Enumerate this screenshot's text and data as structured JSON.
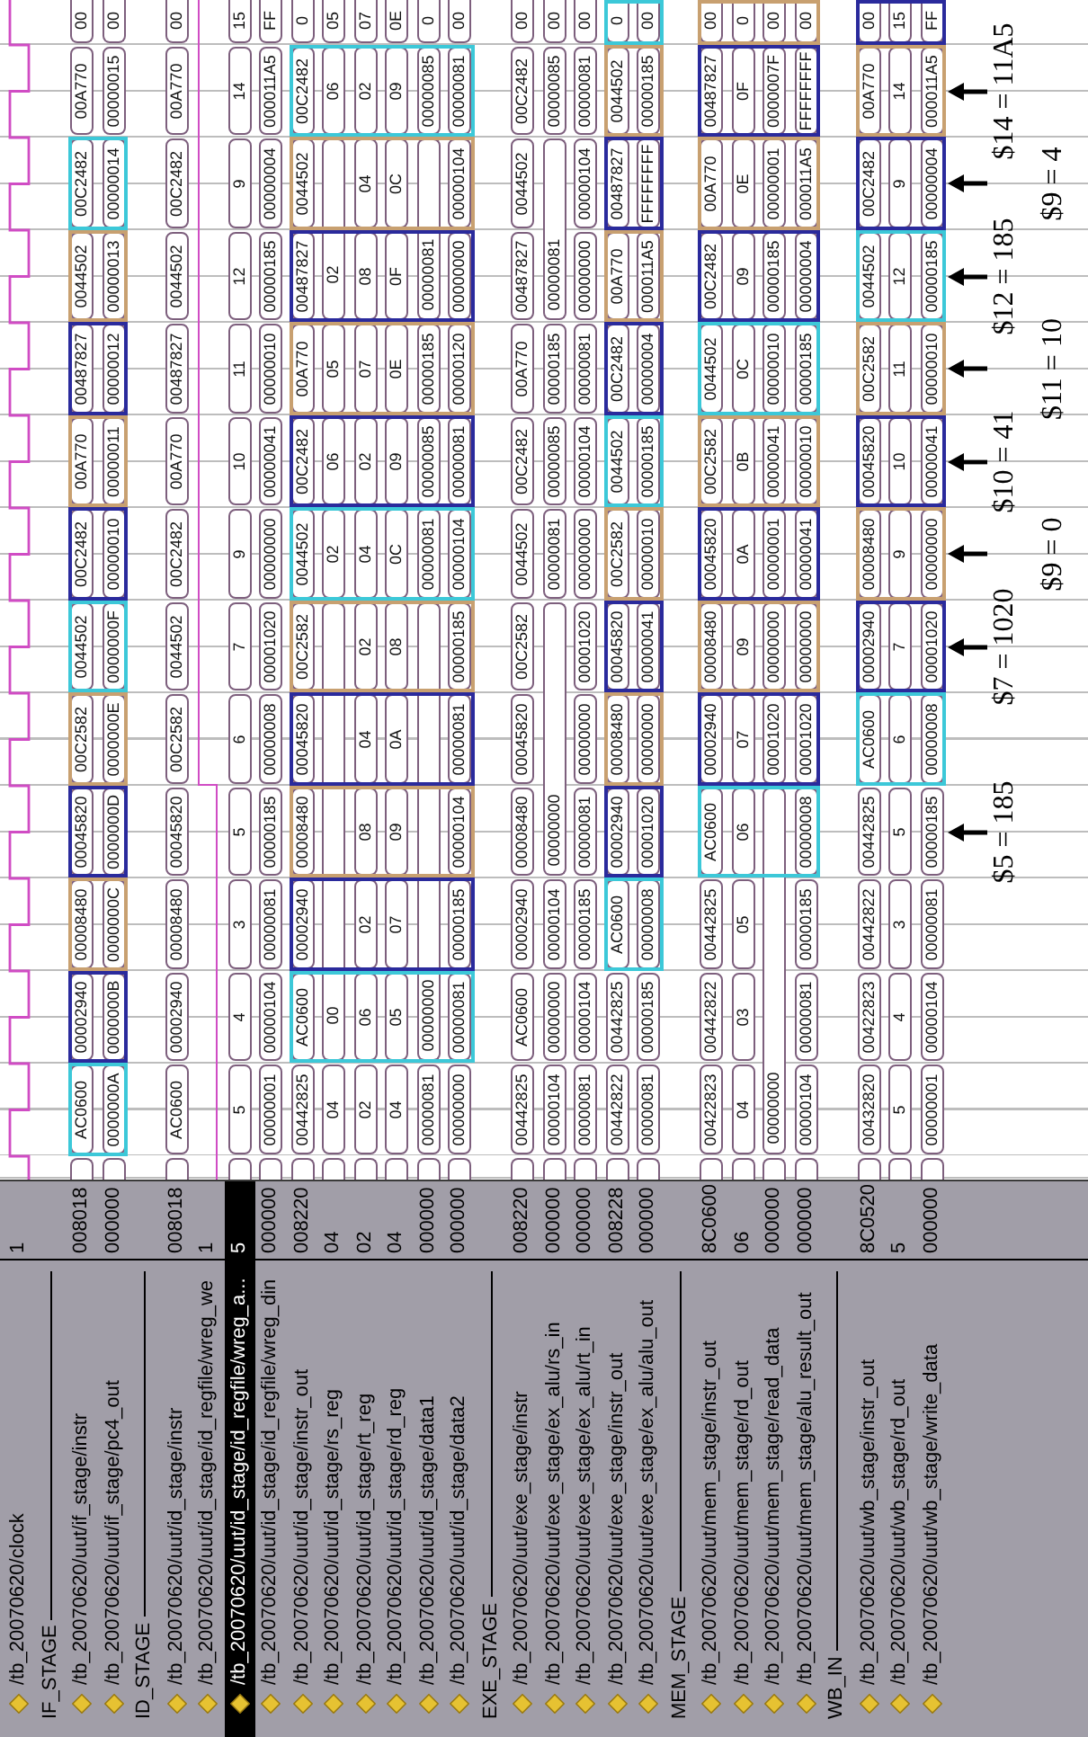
{
  "signals": [
    {
      "kind": "clock",
      "name": "/tb_20070620/clock",
      "value": "1",
      "selected": false
    },
    {
      "kind": "divider",
      "name": "IF_STAGE",
      "selected": false
    },
    {
      "kind": "bus",
      "name": "/tb_20070620/uut/if_stage/instr",
      "value": "008018",
      "selected": false,
      "segments": [
        {
          "value": "AC0600",
          "continues": false,
          "color": "#3cc8d8"
        },
        {
          "value": "00002940",
          "continues": false,
          "color": "#2a2a9c"
        },
        {
          "value": "00008480",
          "continues": false,
          "color": "#c8a070"
        },
        {
          "value": "00045820",
          "continues": false,
          "color": "#2a2a9c"
        },
        {
          "value": "00C2582",
          "continues": false,
          "color": "#c8a070"
        },
        {
          "value": "0044502",
          "continues": false,
          "color": "#3cc8d8"
        },
        {
          "value": "00C2482",
          "continues": false,
          "color": "#2a2a9c"
        },
        {
          "value": "00A770",
          "continues": false,
          "color": "#c8a070"
        },
        {
          "value": "00487827",
          "continues": false,
          "color": "#2a2a9c"
        },
        {
          "value": "0044502",
          "continues": false,
          "color": "#c8a070"
        },
        {
          "value": "00C2482",
          "continues": false,
          "color": "#3cc8d8"
        },
        {
          "value": "00A770",
          "continues": false
        },
        {
          "value": "00",
          "continues": false
        }
      ]
    },
    {
      "kind": "bus",
      "name": "/tb_20070620/uut/if_stage/pc4_out",
      "value": "000000",
      "selected": false,
      "segments": [
        {
          "value": "0000000A",
          "continues": false
        },
        {
          "value": "0000000B",
          "continues": false
        },
        {
          "value": "0000000C",
          "continues": false
        },
        {
          "value": "0000000D",
          "continues": false
        },
        {
          "value": "0000000E",
          "continues": false
        },
        {
          "value": "0000000F",
          "continues": false
        },
        {
          "value": "00000010",
          "continues": false
        },
        {
          "value": "00000011",
          "continues": false
        },
        {
          "value": "00000012",
          "continues": false
        },
        {
          "value": "00000013",
          "continues": false
        },
        {
          "value": "00000014",
          "continues": false
        },
        {
          "value": "00000015",
          "continues": false
        },
        {
          "value": "00",
          "continues": false
        }
      ]
    },
    {
      "kind": "divider",
      "name": "ID_STAGE",
      "selected": false
    },
    {
      "kind": "bus",
      "name": "/tb_20070620/uut/id_stage/instr",
      "value": "008018",
      "selected": false,
      "segments": [
        {
          "value": "AC0600",
          "continues": false
        },
        {
          "value": "00002940",
          "continues": false
        },
        {
          "value": "00008480",
          "continues": false
        },
        {
          "value": "00045820",
          "continues": false
        },
        {
          "value": "00C2582",
          "continues": false
        },
        {
          "value": "0044502",
          "continues": false
        },
        {
          "value": "00C2482",
          "continues": false
        },
        {
          "value": "00A770",
          "continues": false
        },
        {
          "value": "00487827",
          "continues": false
        },
        {
          "value": "0044502",
          "continues": false
        },
        {
          "value": "00C2482",
          "continues": false
        },
        {
          "value": "00A770",
          "continues": false
        },
        {
          "value": "00",
          "continues": false
        }
      ]
    },
    {
      "kind": "bit",
      "name": "/tb_20070620/uut/id_stage/id_regfile/wreg_we",
      "value": "1",
      "selected": false,
      "cycles": [
        {
          "high": false
        },
        {
          "high": false
        },
        {
          "high": false
        },
        {
          "high": false
        },
        {
          "high": true
        },
        {
          "high": true
        },
        {
          "high": true
        },
        {
          "high": true
        },
        {
          "high": true
        },
        {
          "high": true
        },
        {
          "high": true
        },
        {
          "high": true
        },
        {
          "high": true
        }
      ]
    },
    {
      "kind": "bus",
      "name": "/tb_20070620/uut/id_stage/id_regfile/wreg_a...",
      "value": "5",
      "selected": true,
      "segments": [
        {
          "value": "5",
          "continues": false
        },
        {
          "value": "4",
          "continues": false
        },
        {
          "value": "3",
          "continues": false
        },
        {
          "value": "5",
          "continues": false
        },
        {
          "value": "6",
          "continues": false
        },
        {
          "value": "7",
          "continues": false
        },
        {
          "value": "9",
          "continues": false
        },
        {
          "value": "10",
          "continues": false
        },
        {
          "value": "11",
          "continues": false
        },
        {
          "value": "12",
          "continues": false
        },
        {
          "value": "9",
          "continues": false
        },
        {
          "value": "14",
          "continues": false
        },
        {
          "value": "15",
          "continues": false
        }
      ]
    },
    {
      "kind": "bus",
      "name": "/tb_20070620/uut/id_stage/id_regfile/wreg_din",
      "value": "000000",
      "selected": false,
      "segments": [
        {
          "value": "00000001",
          "continues": false
        },
        {
          "value": "00000104",
          "continues": false
        },
        {
          "value": "00000081",
          "continues": false
        },
        {
          "value": "00000185",
          "continues": false
        },
        {
          "value": "00000008",
          "continues": false
        },
        {
          "value": "00001020",
          "continues": false
        },
        {
          "value": "00000000",
          "continues": false
        },
        {
          "value": "00000041",
          "continues": false
        },
        {
          "value": "00000010",
          "continues": false
        },
        {
          "value": "00000185",
          "continues": false
        },
        {
          "value": "00000004",
          "continues": false
        },
        {
          "value": "000011A5",
          "continues": false
        },
        {
          "value": "FF",
          "continues": false
        }
      ]
    },
    {
      "kind": "bus",
      "name": "/tb_20070620/uut/id_stage/instr_out",
      "value": "008220",
      "selected": false,
      "segments": [
        {
          "value": "00442825",
          "continues": false
        },
        {
          "value": "AC0600",
          "continues": false,
          "color": "#3cc8d8"
        },
        {
          "value": "00002940",
          "continues": false,
          "color": "#2a2a9c"
        },
        {
          "value": "00008480",
          "continues": false,
          "color": "#c8a070"
        },
        {
          "value": "00045820",
          "continues": false,
          "color": "#2a2a9c"
        },
        {
          "value": "00C2582",
          "continues": false,
          "color": "#c8a070"
        },
        {
          "value": "0044502",
          "continues": false,
          "color": "#3cc8d8"
        },
        {
          "value": "00C2482",
          "continues": false,
          "color": "#2a2a9c"
        },
        {
          "value": "00A770",
          "continues": false,
          "color": "#c8a070"
        },
        {
          "value": "00487827",
          "continues": false,
          "color": "#2a2a9c"
        },
        {
          "value": "0044502",
          "continues": false,
          "color": "#c8a070"
        },
        {
          "value": "00C2482",
          "continues": false,
          "color": "#3cc8d8"
        },
        {
          "value": "0",
          "continues": false
        }
      ]
    },
    {
      "kind": "bus",
      "name": "/tb_20070620/uut/id_stage/rs_reg",
      "value": "04",
      "selected": false,
      "segments": [
        {
          "value": "04",
          "continues": false
        },
        {
          "value": "00",
          "continues": false
        },
        {
          "continues": true
        },
        {
          "continues": true
        },
        {
          "continues": true
        },
        {
          "continues": true
        },
        {
          "value": "02",
          "continues": false
        },
        {
          "value": "06",
          "continues": false
        },
        {
          "value": "05",
          "continues": false
        },
        {
          "value": "02",
          "continues": false
        },
        {
          "continues": true
        },
        {
          "value": "06",
          "continues": false
        },
        {
          "value": "05",
          "continues": false
        }
      ]
    },
    {
      "kind": "bus",
      "name": "/tb_20070620/uut/id_stage/rt_reg",
      "value": "02",
      "selected": false,
      "segments": [
        {
          "value": "02",
          "continues": false
        },
        {
          "value": "06",
          "continues": false
        },
        {
          "value": "02",
          "continues": false
        },
        {
          "value": "08",
          "continues": false
        },
        {
          "value": "04",
          "continues": false
        },
        {
          "value": "02",
          "continues": false
        },
        {
          "value": "04",
          "continues": false
        },
        {
          "value": "02",
          "continues": false
        },
        {
          "value": "07",
          "continues": false
        },
        {
          "value": "08",
          "continues": false
        },
        {
          "value": "04",
          "continues": false
        },
        {
          "value": "02",
          "continues": false
        },
        {
          "value": "07",
          "continues": false
        }
      ]
    },
    {
      "kind": "bus",
      "name": "/tb_20070620/uut/id_stage/rd_reg",
      "value": "04",
      "selected": false,
      "segments": [
        {
          "value": "04",
          "continues": false
        },
        {
          "value": "05",
          "continues": false
        },
        {
          "value": "07",
          "continues": false
        },
        {
          "value": "09",
          "continues": false
        },
        {
          "value": "0A",
          "continues": false
        },
        {
          "value": "08",
          "continues": false
        },
        {
          "value": "0C",
          "continues": false
        },
        {
          "value": "09",
          "continues": false
        },
        {
          "value": "0E",
          "continues": false
        },
        {
          "value": "0F",
          "continues": false
        },
        {
          "value": "0C",
          "continues": false
        },
        {
          "value": "09",
          "continues": false
        },
        {
          "value": "0E",
          "continues": false
        }
      ]
    },
    {
      "kind": "bus",
      "name": "/tb_20070620/uut/id_stage/data1",
      "value": "000000",
      "selected": false,
      "segments": [
        {
          "value": "00000081",
          "continues": false
        },
        {
          "value": "00000000",
          "continues": false
        },
        {
          "continues": true
        },
        {
          "continues": true
        },
        {
          "continues": true
        },
        {
          "continues": true
        },
        {
          "value": "00000081",
          "continues": false
        },
        {
          "value": "00000085",
          "continues": false
        },
        {
          "value": "00000185",
          "continues": false
        },
        {
          "value": "00000081",
          "continues": false
        },
        {
          "continues": true
        },
        {
          "value": "00000085",
          "continues": false
        },
        {
          "value": "0",
          "continues": false
        }
      ]
    },
    {
      "kind": "bus",
      "name": "/tb_20070620/uut/id_stage/data2",
      "value": "000000",
      "selected": false,
      "segments": [
        {
          "value": "00000000",
          "continues": false
        },
        {
          "value": "00000081",
          "continues": false
        },
        {
          "value": "00000185",
          "continues": false
        },
        {
          "value": "00000104",
          "continues": false
        },
        {
          "value": "00000081",
          "continues": false
        },
        {
          "value": "00000185",
          "continues": false
        },
        {
          "value": "00000104",
          "continues": false
        },
        {
          "value": "00000081",
          "continues": false
        },
        {
          "value": "00000120",
          "continues": false
        },
        {
          "value": "00000000",
          "continues": false
        },
        {
          "value": "00000104",
          "continues": false
        },
        {
          "value": "00000081",
          "continues": false
        },
        {
          "value": "00",
          "continues": false
        }
      ]
    },
    {
      "kind": "divider",
      "name": "EXE_STAGE",
      "selected": false
    },
    {
      "kind": "bus",
      "name": "/tb_20070620/uut/exe_stage/instr",
      "value": "008220",
      "selected": false,
      "segments": [
        {
          "value": "00442825",
          "continues": false
        },
        {
          "value": "AC0600",
          "continues": false
        },
        {
          "value": "00002940",
          "continues": false
        },
        {
          "value": "00008480",
          "continues": false
        },
        {
          "value": "00045820",
          "continues": false
        },
        {
          "value": "00C2582",
          "continues": false
        },
        {
          "value": "0044502",
          "continues": false
        },
        {
          "value": "00C2482",
          "continues": false
        },
        {
          "value": "00A770",
          "continues": false
        },
        {
          "value": "00487827",
          "continues": false
        },
        {
          "value": "0044502",
          "continues": false
        },
        {
          "value": "00C2482",
          "continues": false
        },
        {
          "value": "00",
          "continues": false
        }
      ]
    },
    {
      "kind": "bus",
      "name": "/tb_20070620/uut/exe_stage/ex_alu/rs_in",
      "value": "000000",
      "selected": false,
      "segments": [
        {
          "value": "00000104",
          "continues": false
        },
        {
          "value": "00000000",
          "continues": false
        },
        {
          "value": "00000104",
          "continues": false
        },
        {
          "value": "00000000",
          "continues": false
        },
        {
          "continues": true
        },
        {
          "continues": true
        },
        {
          "value": "00000081",
          "continues": false
        },
        {
          "value": "00000085",
          "continues": false
        },
        {
          "value": "00000185",
          "continues": false
        },
        {
          "value": "00000081",
          "continues": false
        },
        {
          "continues": true
        },
        {
          "value": "00000085",
          "continues": false
        },
        {
          "value": "00",
          "continues": false
        }
      ]
    },
    {
      "kind": "bus",
      "name": "/tb_20070620/uut/exe_stage/ex_alu/rt_in",
      "value": "000000",
      "selected": false,
      "segments": [
        {
          "value": "00000081",
          "continues": false
        },
        {
          "value": "00000104",
          "continues": false
        },
        {
          "value": "00000185",
          "continues": false
        },
        {
          "value": "00000081",
          "continues": false
        },
        {
          "value": "00000000",
          "continues": false
        },
        {
          "value": "00001020",
          "continues": false
        },
        {
          "value": "00000000",
          "continues": false
        },
        {
          "value": "00000104",
          "continues": false
        },
        {
          "value": "00000081",
          "continues": false
        },
        {
          "value": "00000000",
          "continues": false
        },
        {
          "value": "00000104",
          "continues": false
        },
        {
          "value": "00000081",
          "continues": false
        },
        {
          "value": "00",
          "continues": false
        }
      ]
    },
    {
      "kind": "bus",
      "name": "/tb_20070620/uut/exe_stage/instr_out",
      "value": "008228",
      "selected": false,
      "segments": [
        {
          "value": "00442822",
          "continues": false
        },
        {
          "value": "00442825",
          "continues": false
        },
        {
          "value": "AC0600",
          "continues": false,
          "color": "#3cc8d8"
        },
        {
          "value": "00002940",
          "continues": false,
          "color": "#2a2a9c"
        },
        {
          "value": "00008480",
          "continues": false,
          "color": "#c8a070"
        },
        {
          "value": "00045820",
          "continues": false,
          "color": "#2a2a9c"
        },
        {
          "value": "00C2582",
          "continues": false,
          "color": "#c8a070"
        },
        {
          "value": "0044502",
          "continues": false,
          "color": "#3cc8d8"
        },
        {
          "value": "00C2482",
          "continues": false,
          "color": "#2a2a9c"
        },
        {
          "value": "00A770",
          "continues": false,
          "color": "#c8a070"
        },
        {
          "value": "00487827",
          "continues": false,
          "color": "#2a2a9c"
        },
        {
          "value": "0044502",
          "continues": false,
          "color": "#c8a070"
        },
        {
          "value": "0",
          "continues": false,
          "color": "#3cc8d8"
        }
      ]
    },
    {
      "kind": "bus",
      "name": "/tb_20070620/uut/exe_stage/ex_alu/alu_out",
      "value": "000000",
      "selected": false,
      "segments": [
        {
          "value": "00000081",
          "continues": false
        },
        {
          "value": "00000185",
          "continues": false
        },
        {
          "value": "00000008",
          "continues": false
        },
        {
          "value": "00001020",
          "continues": false
        },
        {
          "value": "00000000",
          "continues": false
        },
        {
          "value": "00000041",
          "continues": false
        },
        {
          "value": "00000010",
          "continues": false
        },
        {
          "value": "00000185",
          "continues": false
        },
        {
          "value": "00000004",
          "continues": false
        },
        {
          "value": "000011A5",
          "continues": false
        },
        {
          "value": "FFFFFFFF",
          "continues": false
        },
        {
          "value": "00000185",
          "continues": false
        },
        {
          "value": "00",
          "continues": false
        }
      ]
    },
    {
      "kind": "divider",
      "name": "MEM_STAGE",
      "selected": false
    },
    {
      "kind": "bus",
      "name": "/tb_20070620/uut/mem_stage/instr_out",
      "value": "8C0600",
      "selected": false,
      "segments": [
        {
          "value": "00422823",
          "continues": false
        },
        {
          "value": "00442822",
          "continues": false
        },
        {
          "value": "00442825",
          "continues": false
        },
        {
          "value": "AC0600",
          "continues": false,
          "color": "#3cc8d8"
        },
        {
          "value": "00002940",
          "continues": false,
          "color": "#2a2a9c"
        },
        {
          "value": "00008480",
          "continues": false,
          "color": "#c8a070"
        },
        {
          "value": "00045820",
          "continues": false,
          "color": "#2a2a9c"
        },
        {
          "value": "00C2582",
          "continues": false,
          "color": "#c8a070"
        },
        {
          "value": "0044502",
          "continues": false,
          "color": "#3cc8d8"
        },
        {
          "value": "00C2482",
          "continues": false,
          "color": "#2a2a9c"
        },
        {
          "value": "00A770",
          "continues": false,
          "color": "#c8a070"
        },
        {
          "value": "00487827",
          "continues": false,
          "color": "#2a2a9c"
        },
        {
          "value": "00",
          "continues": false,
          "color": "#c8a070"
        }
      ]
    },
    {
      "kind": "bus",
      "name": "/tb_20070620/uut/mem_stage/rd_out",
      "value": "06",
      "selected": false,
      "segments": [
        {
          "value": "04",
          "continues": false
        },
        {
          "value": "03",
          "continues": false
        },
        {
          "value": "05",
          "continues": false
        },
        {
          "value": "06",
          "continues": false
        },
        {
          "value": "07",
          "continues": false
        },
        {
          "value": "09",
          "continues": false
        },
        {
          "value": "0A",
          "continues": false
        },
        {
          "value": "0B",
          "continues": false
        },
        {
          "value": "0C",
          "continues": false
        },
        {
          "value": "09",
          "continues": false
        },
        {
          "value": "0E",
          "continues": false
        },
        {
          "value": "0F",
          "continues": false
        },
        {
          "value": "0",
          "continues": false
        }
      ]
    },
    {
      "kind": "bus",
      "name": "/tb_20070620/uut/mem_stage/read_data",
      "value": "000000",
      "selected": false,
      "segments": [
        {
          "value": "00000000",
          "continues": false
        },
        {
          "continues": true
        },
        {
          "continues": true
        },
        {
          "continues": true
        },
        {
          "value": "00001020",
          "continues": false
        },
        {
          "value": "00000000",
          "continues": false
        },
        {
          "value": "00000001",
          "continues": false
        },
        {
          "value": "00000041",
          "continues": false
        },
        {
          "value": "00000010",
          "continues": false
        },
        {
          "value": "00000185",
          "continues": false
        },
        {
          "value": "00000001",
          "continues": false
        },
        {
          "value": "0000007F",
          "continues": false
        },
        {
          "value": "00",
          "continues": false
        }
      ]
    },
    {
      "kind": "bus",
      "name": "/tb_20070620/uut/mem_stage/alu_result_out",
      "value": "000000",
      "selected": false,
      "segments": [
        {
          "value": "00000104",
          "continues": false
        },
        {
          "value": "00000081",
          "continues": false
        },
        {
          "value": "00000185",
          "continues": false
        },
        {
          "value": "00000008",
          "continues": false
        },
        {
          "value": "00001020",
          "continues": false
        },
        {
          "value": "00000000",
          "continues": false
        },
        {
          "value": "00000041",
          "continues": false
        },
        {
          "value": "00000010",
          "continues": false
        },
        {
          "value": "00000185",
          "continues": false
        },
        {
          "value": "00000004",
          "continues": false
        },
        {
          "value": "000011A5",
          "continues": false
        },
        {
          "value": "FFFFFFFF",
          "continues": false
        },
        {
          "value": "00",
          "continues": false
        }
      ]
    },
    {
      "kind": "divider",
      "name": "WB_IN",
      "selected": false
    },
    {
      "kind": "bus",
      "name": "/tb_20070620/uut/wb_stage/instr_out",
      "value": "8C0520",
      "selected": false,
      "segments": [
        {
          "value": "00432820",
          "continues": false
        },
        {
          "value": "00422823",
          "continues": false
        },
        {
          "value": "00442822",
          "continues": false
        },
        {
          "value": "00442825",
          "continues": false
        },
        {
          "value": "AC0600",
          "continues": false,
          "color": "#3cc8d8"
        },
        {
          "value": "00002940",
          "continues": false,
          "color": "#2a2a9c"
        },
        {
          "value": "00008480",
          "continues": false,
          "color": "#c8a070"
        },
        {
          "value": "00045820",
          "continues": false,
          "color": "#2a2a9c"
        },
        {
          "value": "00C2582",
          "continues": false,
          "color": "#c8a070"
        },
        {
          "value": "0044502",
          "continues": false,
          "color": "#3cc8d8"
        },
        {
          "value": "00C2482",
          "continues": false,
          "color": "#2a2a9c"
        },
        {
          "value": "00A770",
          "continues": false,
          "color": "#c8a070"
        },
        {
          "value": "00",
          "continues": false,
          "color": "#2a2a9c"
        }
      ]
    },
    {
      "kind": "bus",
      "name": "/tb_20070620/uut/wb_stage/rd_out",
      "value": "5",
      "selected": false,
      "segments": [
        {
          "value": "5",
          "continues": false
        },
        {
          "value": "4",
          "continues": false
        },
        {
          "value": "3",
          "continues": false
        },
        {
          "value": "5",
          "continues": false
        },
        {
          "value": "6",
          "continues": false
        },
        {
          "value": "7",
          "continues": false
        },
        {
          "value": "9",
          "continues": false
        },
        {
          "value": "10",
          "continues": false
        },
        {
          "value": "11",
          "continues": false
        },
        {
          "value": "12",
          "continues": false
        },
        {
          "value": "9",
          "continues": false
        },
        {
          "value": "14",
          "continues": false
        },
        {
          "value": "15",
          "continues": false
        }
      ]
    },
    {
      "kind": "bus",
      "name": "/tb_20070620/uut/wb_stage/write_data",
      "value": "000000",
      "selected": false,
      "segments": [
        {
          "value": "00000001",
          "continues": false
        },
        {
          "value": "00000104",
          "continues": false
        },
        {
          "value": "00000081",
          "continues": false
        },
        {
          "value": "00000185",
          "continues": false,
          "note": "$5 = 185"
        },
        {
          "value": "00000008",
          "continues": false
        },
        {
          "value": "00001020",
          "continues": false,
          "note": "$7 = 1020"
        },
        {
          "value": "00000000",
          "continues": false,
          "note": "$9 = 0"
        },
        {
          "value": "00000041",
          "continues": false,
          "note": "$10 = 41"
        },
        {
          "value": "00000010",
          "continues": false,
          "note": "$11 = 10"
        },
        {
          "value": "00000185",
          "continues": false,
          "note": "$12 = 185"
        },
        {
          "value": "00000004",
          "continues": false,
          "note": "$9 = 4"
        },
        {
          "value": "000011A5",
          "continues": false,
          "note": "$14 = 11A5"
        },
        {
          "value": "FF",
          "continues": false
        }
      ]
    }
  ]
}
